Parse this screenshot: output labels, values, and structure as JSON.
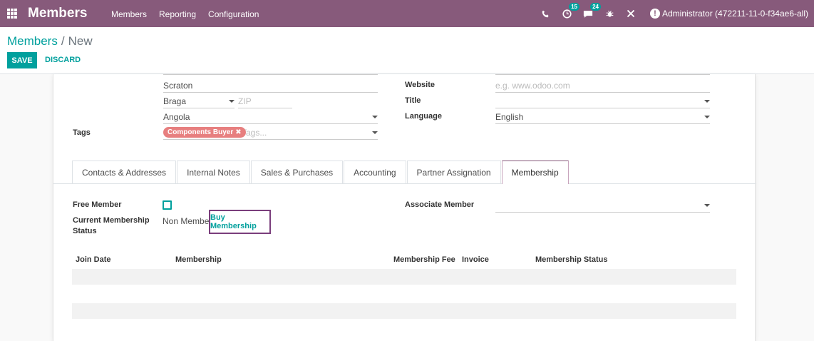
{
  "navbar": {
    "brand": "Members",
    "menu": [
      "Members",
      "Reporting",
      "Configuration"
    ],
    "systray": {
      "phone_icon": "phone-icon",
      "activity_badge": "15",
      "messages_badge": "24",
      "bug_icon": "bug-icon",
      "tools_icon": "tools-icon"
    },
    "user": "Administrator (472211-11-0-f34ae6-all)"
  },
  "control_panel": {
    "breadcrumb": {
      "parent": "Members",
      "separator": "/",
      "current": "New"
    },
    "save_label": "SAVE",
    "discard_label": "DISCARD"
  },
  "form": {
    "street2": "Scraton",
    "city": "Braga",
    "zip_placeholder": "ZIP",
    "country": "Angola",
    "tags_label": "Tags",
    "tag": "Components Buyer",
    "tags_placeholder": "Tags...",
    "website_label": "Website",
    "website_placeholder": "e.g. www.odoo.com",
    "title_label": "Title",
    "language_label": "Language",
    "language": "English"
  },
  "tabs": [
    {
      "label": "Contacts & Addresses",
      "active": false
    },
    {
      "label": "Internal Notes",
      "active": false
    },
    {
      "label": "Sales & Purchases",
      "active": false
    },
    {
      "label": "Accounting",
      "active": false
    },
    {
      "label": "Partner Assignation",
      "active": false
    },
    {
      "label": "Membership",
      "active": true
    }
  ],
  "membership": {
    "free_member_label": "Free Member",
    "free_member_checked": false,
    "status_label_line1": "Current Membership",
    "status_label_line2": "Status",
    "status_value": "Non Member",
    "buy_button": "Buy Membership",
    "associate_label": "Associate Member",
    "table_headers": [
      "Join Date",
      "Membership",
      "Membership Fee",
      "Invoice",
      "Membership Status"
    ]
  }
}
